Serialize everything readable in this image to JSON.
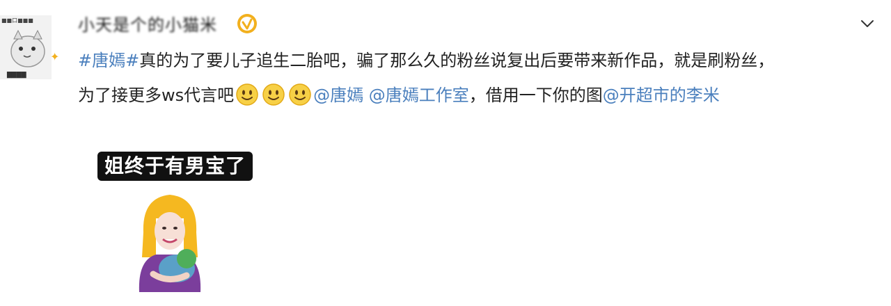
{
  "post": {
    "username": "小天是个的小猫米",
    "verified_badge": "verified-icon",
    "expand_icon": "chevron-down-icon",
    "hashtag": "#唐嫣#",
    "line1_text": "真的为了要儿子追生二胎吧，骗了那么久的粉丝说复出后要带来新作品，就是刷粉丝，",
    "line2_text": "为了接更多ws代言吧",
    "emoji_name": "smile-emoji",
    "mention1": "@唐嫣",
    "mention2": "@唐嫣工作室",
    "middle_text": "，借用一下你的图",
    "mention3": "@开超市的李米",
    "sticker_caption": "姐终于有男宝了"
  },
  "colors": {
    "link": "#4a7fbd",
    "text": "#222222",
    "verified": "#f2b01e"
  }
}
